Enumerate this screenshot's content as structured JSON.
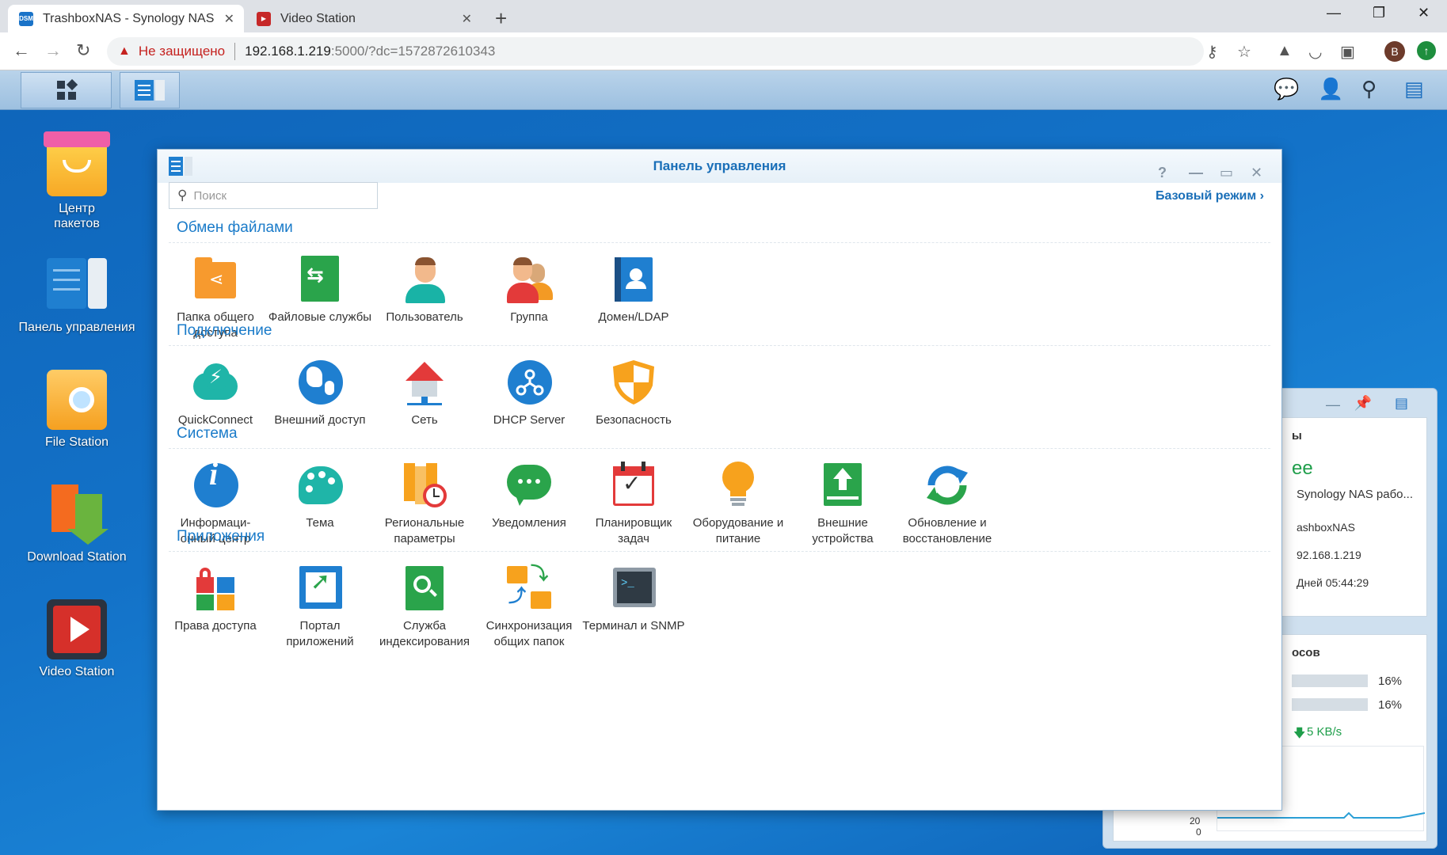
{
  "browser": {
    "tabs": [
      {
        "title": "TrashboxNAS - Synology NAS",
        "favicon": "DSM"
      },
      {
        "title": "Video Station"
      }
    ],
    "security_label": "Не защищено",
    "url_host": "192.168.1.219",
    "url_rest": ":5000/?dc=1572872610343",
    "profile_initial": "B"
  },
  "desktop": {
    "icons": [
      {
        "label": "Центр пакетов"
      },
      {
        "label": "Панель управления"
      },
      {
        "label": "File Station"
      },
      {
        "label": "Download Station"
      },
      {
        "label": "Video Station"
      }
    ]
  },
  "window": {
    "title": "Панель управления",
    "search_placeholder": "Поиск",
    "basic_mode": "Базовый режим",
    "sections": [
      {
        "title": "Обмен файлами",
        "items": [
          "Папка общего доступа",
          "Файловые службы",
          "Пользователь",
          "Группа",
          "Домен/LDAP"
        ]
      },
      {
        "title": "Подключение",
        "items": [
          "QuickConnect",
          "Внешний доступ",
          "Сеть",
          "DHCP Server",
          "Безопасность"
        ]
      },
      {
        "title": "Система",
        "items": [
          "Информаци-онный центр",
          "Тема",
          "Региональные параметры",
          "Уведомления",
          "Планировщик задач",
          "Оборудование и питание",
          "Внешние устройства",
          "Обновление и восстановление"
        ]
      },
      {
        "title": "Приложения",
        "items": [
          "Права доступа",
          "Портал приложений",
          "Служба индексирования",
          "Синхронизация общих папок",
          "Терминал и SNMP"
        ]
      }
    ]
  },
  "widget": {
    "lines": [
      "ы",
      "ee",
      "Synology NAS рабо...",
      "ashboxNAS",
      "92.168.1.219",
      "Дней 05:44:29"
    ],
    "resource_title": "осов",
    "cpu_pct": "16%",
    "ram_pct": "16%",
    "cpu_value": 0.16,
    "ram_value": 0.16,
    "net_speed": "5 KB/s",
    "axis_labels": [
      "20",
      "0"
    ]
  },
  "colors": {
    "accent": "#1a7bc9",
    "title": "#1a6fb8"
  }
}
